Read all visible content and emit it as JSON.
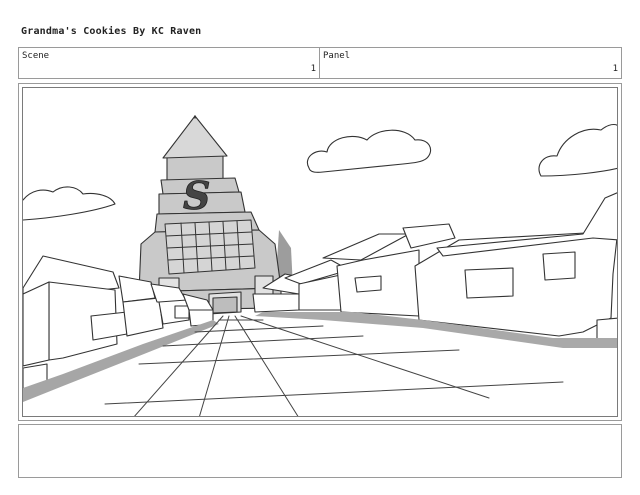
{
  "header": {
    "title": "Grandma's Cookies  By KC Raven"
  },
  "scene": {
    "label": "Scene",
    "number": "1"
  },
  "panel": {
    "label": "Panel",
    "number": "1"
  },
  "drawing": {
    "tower_letter": "S"
  },
  "notes": {
    "text": ""
  }
}
